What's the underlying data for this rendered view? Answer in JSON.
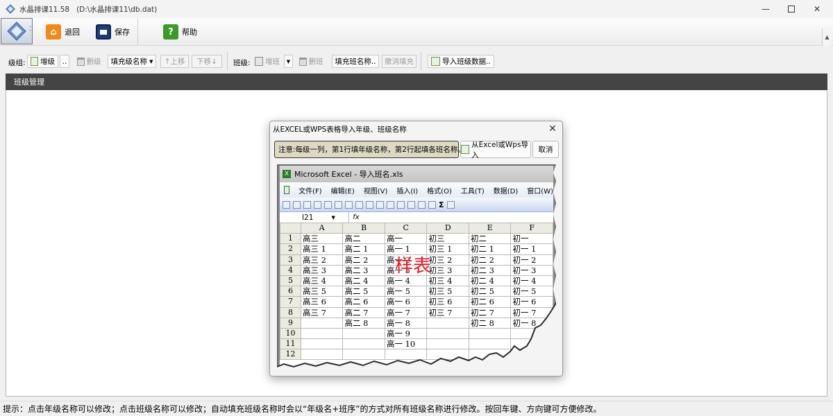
{
  "window": {
    "title": "水晶排课11.58",
    "path": "(D:\\水晶排课11\\db.dat)"
  },
  "main_toolbar": {
    "back_label": "退回",
    "save_label": "保存",
    "help_label": "帮助"
  },
  "toolbar2": {
    "grade_label": "级组:",
    "add_grade": "增级",
    "more": "..",
    "delete_grade": "删级",
    "fill_grade_names": "填充级名称",
    "move_up": "↑上移",
    "move_down": "下移↓",
    "class_label": "班级:",
    "add_class": "增班",
    "delete_class": "删班",
    "fill_class_names": "填充班名称..",
    "cancel_fill": "撤消填充",
    "import_class_data": "导入班级数据.."
  },
  "panel": {
    "title": "班级管理"
  },
  "status": {
    "text": "提示：点击年级名称可以修改；点击班级名称可以修改；自动填充班级名称时会以“年级名+班序”的方式对所有班级名称进行修改。按回车键、方向键可方便修改。"
  },
  "dialog": {
    "title": "从EXCEL或WPS表格导入年级、班级名称",
    "note": "注意:每级一列，第1行填年级名称，第2行起填各班名称。",
    "import_button": "从Excel或Wps导入",
    "cancel_button": "取消",
    "sample_label": "样表",
    "excel": {
      "title": "Microsoft Excel - 导入班名.xls",
      "menu": [
        "文件(F)",
        "编辑(E)",
        "视图(V)",
        "插入(I)",
        "格式(O)",
        "工具(T)",
        "数据(D)",
        "窗口(W)"
      ],
      "name_box": "I21",
      "fx": "fx",
      "columns": [
        "A",
        "B",
        "C",
        "D",
        "E",
        "F"
      ],
      "rows": [
        {
          "n": "1",
          "cells": [
            "高三",
            "高二",
            "高一",
            "初三",
            "初二",
            "初一"
          ]
        },
        {
          "n": "2",
          "cells": [
            "高三 1",
            "高二 1",
            "高一 1",
            "初三 1",
            "初二 1",
            "初一 1"
          ]
        },
        {
          "n": "3",
          "cells": [
            "高三 2",
            "高二 2",
            "高一 2",
            "初三 2",
            "初二 2",
            "初一 2"
          ]
        },
        {
          "n": "4",
          "cells": [
            "高三 3",
            "高二 3",
            "高一 3",
            "初三 3",
            "初二 3",
            "初一 3"
          ]
        },
        {
          "n": "5",
          "cells": [
            "高三 4",
            "高二 4",
            "高一 4",
            "初三 4",
            "初二 4",
            "初一 4"
          ]
        },
        {
          "n": "6",
          "cells": [
            "高三 5",
            "高二 5",
            "高一 5",
            "初三 5",
            "初二 5",
            "初一 5"
          ]
        },
        {
          "n": "7",
          "cells": [
            "高三 6",
            "高二 6",
            "高一 6",
            "初三 6",
            "初二 6",
            "初一 6"
          ]
        },
        {
          "n": "8",
          "cells": [
            "高三 7",
            "高二 7",
            "高一 7",
            "初三 7",
            "初二 7",
            "初一 7"
          ]
        },
        {
          "n": "9",
          "cells": [
            "",
            "高二 8",
            "高一 8",
            "",
            "初二 8",
            "初一 8"
          ]
        },
        {
          "n": "10",
          "cells": [
            "",
            "",
            "高一 9",
            "",
            "",
            ""
          ]
        },
        {
          "n": "11",
          "cells": [
            "",
            "",
            "高一 10",
            "",
            "",
            ""
          ]
        },
        {
          "n": "12",
          "cells": [
            "",
            "",
            "",
            "",
            "",
            ""
          ]
        }
      ]
    }
  },
  "colors": {
    "panel_header": "#444444",
    "sample_label": "#e8141e",
    "note_bg": "#ddd9c2"
  }
}
